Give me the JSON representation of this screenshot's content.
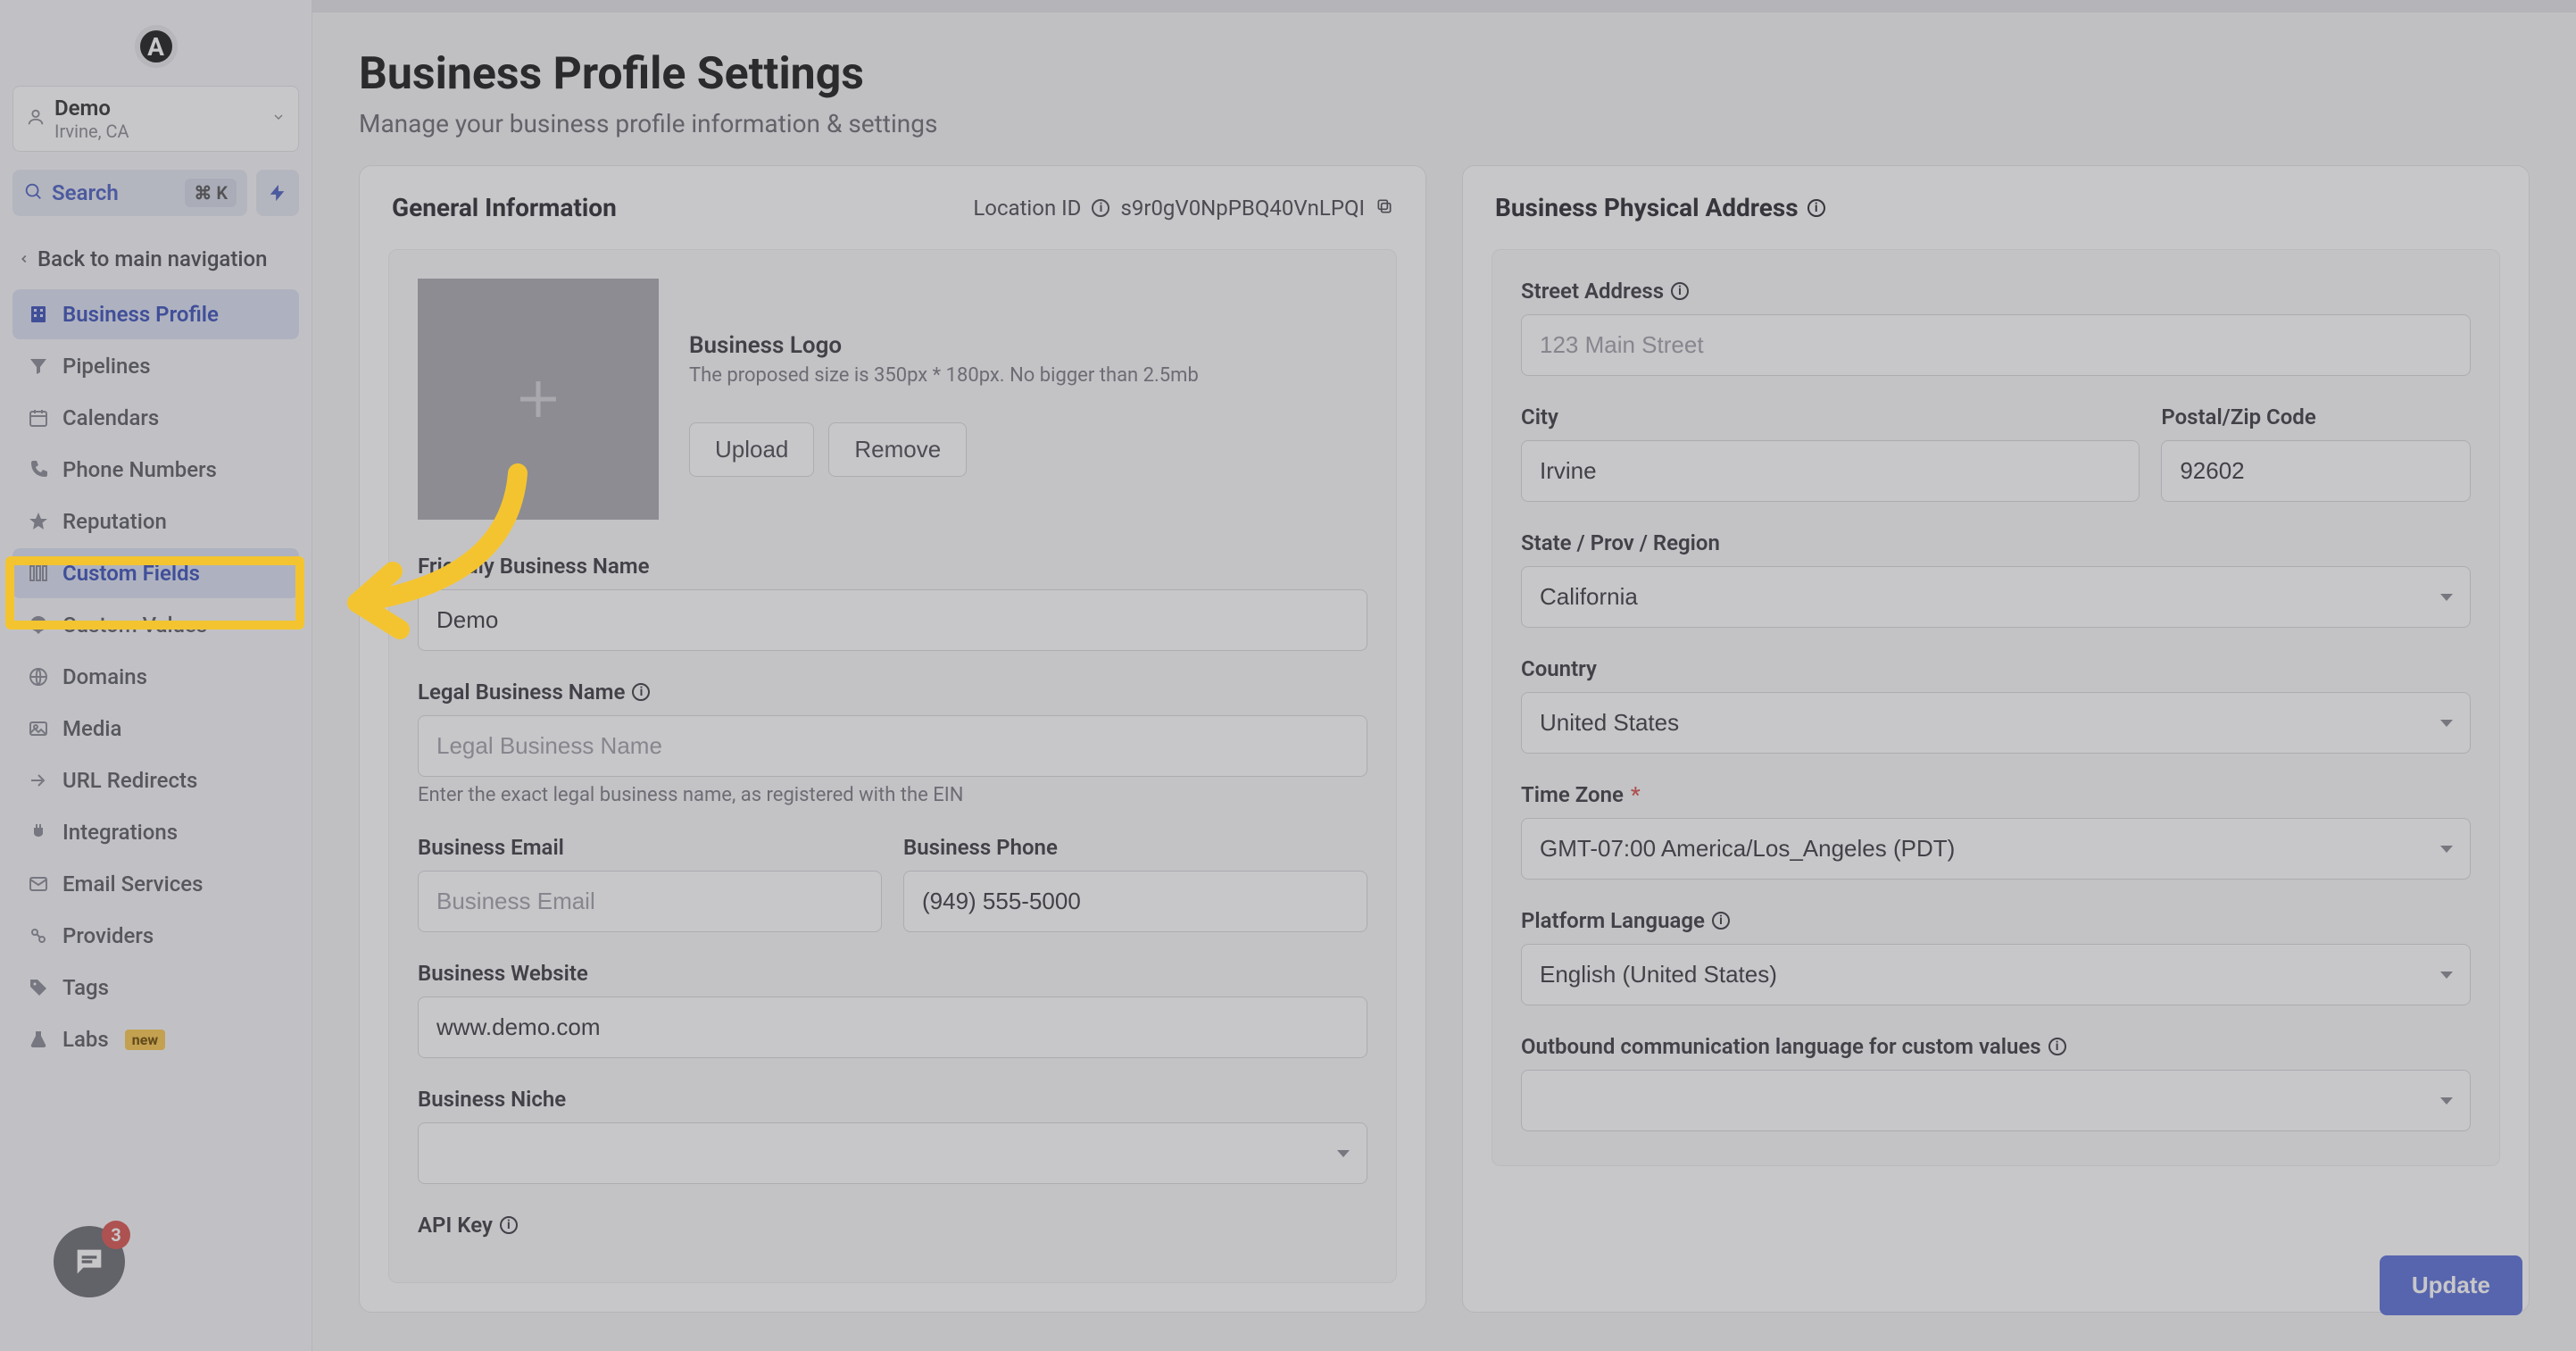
{
  "logo_letter": "A",
  "location": {
    "name": "Demo",
    "sub": "Irvine, CA"
  },
  "search": {
    "label": "Search",
    "shortcut": "⌘ K"
  },
  "back_nav": "Back to main navigation",
  "nav": [
    {
      "label": "Business Profile",
      "icon": "building"
    },
    {
      "label": "Pipelines",
      "icon": "funnel"
    },
    {
      "label": "Calendars",
      "icon": "calendar"
    },
    {
      "label": "Phone Numbers",
      "icon": "phone"
    },
    {
      "label": "Reputation",
      "icon": "star"
    },
    {
      "label": "Custom Fields",
      "icon": "fields"
    },
    {
      "label": "Custom Values",
      "icon": "tag"
    },
    {
      "label": "Domains",
      "icon": "globe"
    },
    {
      "label": "Media",
      "icon": "image"
    },
    {
      "label": "URL Redirects",
      "icon": "redirect"
    },
    {
      "label": "Integrations",
      "icon": "plug"
    },
    {
      "label": "Email Services",
      "icon": "mail"
    },
    {
      "label": "Providers",
      "icon": "providers"
    },
    {
      "label": "Tags",
      "icon": "tags"
    },
    {
      "label": "Labs",
      "icon": "flask",
      "badge": "new"
    }
  ],
  "page": {
    "title": "Business Profile Settings",
    "subtitle": "Manage your business profile information & settings"
  },
  "general": {
    "title": "General Information",
    "location_id_label": "Location ID",
    "location_id": "s9r0gV0NpPBQ40VnLPQI",
    "logo_label": "Business Logo",
    "logo_hint": "The proposed size is 350px * 180px. No bigger than 2.5mb",
    "upload": "Upload",
    "remove": "Remove",
    "friendly_name_label": "Friendly Business Name",
    "friendly_name_value": "Demo",
    "legal_name_label": "Legal Business Name",
    "legal_name_placeholder": "Legal Business Name",
    "legal_name_hint": "Enter the exact legal business name, as registered with the EIN",
    "email_label": "Business Email",
    "email_placeholder": "Business Email",
    "phone_label": "Business Phone",
    "phone_value": "(949) 555-5000",
    "website_label": "Business Website",
    "website_value": "www.demo.com",
    "niche_label": "Business Niche",
    "api_key_label": "API Key"
  },
  "address": {
    "title": "Business Physical Address",
    "street_label": "Street Address",
    "street_placeholder": "123 Main Street",
    "city_label": "City",
    "city_value": "Irvine",
    "zip_label": "Postal/Zip Code",
    "zip_value": "92602",
    "state_label": "State / Prov / Region",
    "state_value": "California",
    "country_label": "Country",
    "country_value": "United States",
    "tz_label": "Time Zone",
    "tz_value": "GMT-07:00 America/Los_Angeles (PDT)",
    "lang_label": "Platform Language",
    "lang_value": "English (United States)",
    "outbound_label": "Outbound communication language for custom values"
  },
  "update_btn": "Update",
  "chat_badge": "3"
}
